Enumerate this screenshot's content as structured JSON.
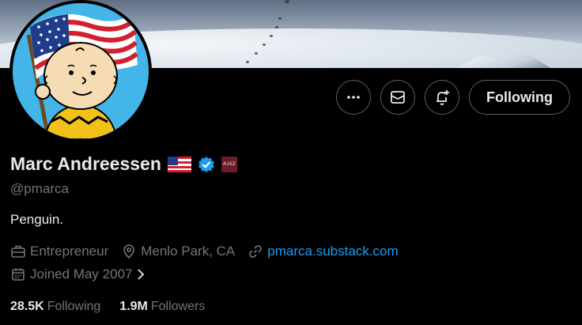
{
  "profile": {
    "name": "Marc Andreessen",
    "handle": "@pmarca",
    "bio": "Penguin.",
    "badge_label": "A16Z",
    "profession": "Entrepreneur",
    "location": "Menlo Park, CA",
    "website": "pmarca.substack.com",
    "joined": "Joined May 2007"
  },
  "actions": {
    "more_icon": "ellipsis-icon",
    "message_icon": "envelope-icon",
    "notify_icon": "bell-plus-icon",
    "follow_label": "Following"
  },
  "stats": {
    "following_count": "28.5K",
    "following_label": "Following",
    "followers_count": "1.9M",
    "followers_label": "Followers"
  },
  "colors": {
    "background": "#000000",
    "text_primary": "#e7e9ea",
    "text_secondary": "#71767b",
    "link": "#1d9bf0",
    "verified": "#1d9bf0",
    "button_border": "#536471"
  }
}
